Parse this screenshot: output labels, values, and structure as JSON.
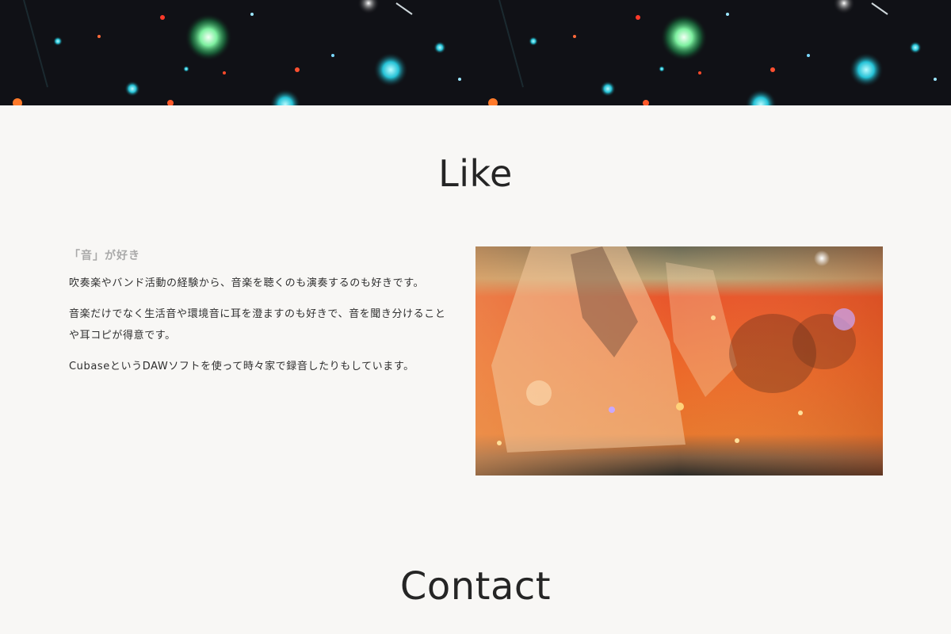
{
  "hero": {
    "image": "concert-stage-lights-photo"
  },
  "like": {
    "title": "Like",
    "heading": "「音」が好き",
    "paragraphs": [
      "吹奏楽やバンド活動の経験から、音楽を聴くのも演奏するのも好きです。",
      "音楽だけでなく生活音や環境音に耳を澄ますのも好きで、音を聞き分けることや耳コピが得意です。",
      "CubaseというDAWソフトを使って時々家で録音したりもしています。"
    ],
    "photo": "band-performance-photo"
  },
  "contact": {
    "title": "Contact"
  },
  "colors": {
    "background": "#f8f7f5",
    "text": "#252525",
    "heading_muted": "#a9a9a9"
  }
}
